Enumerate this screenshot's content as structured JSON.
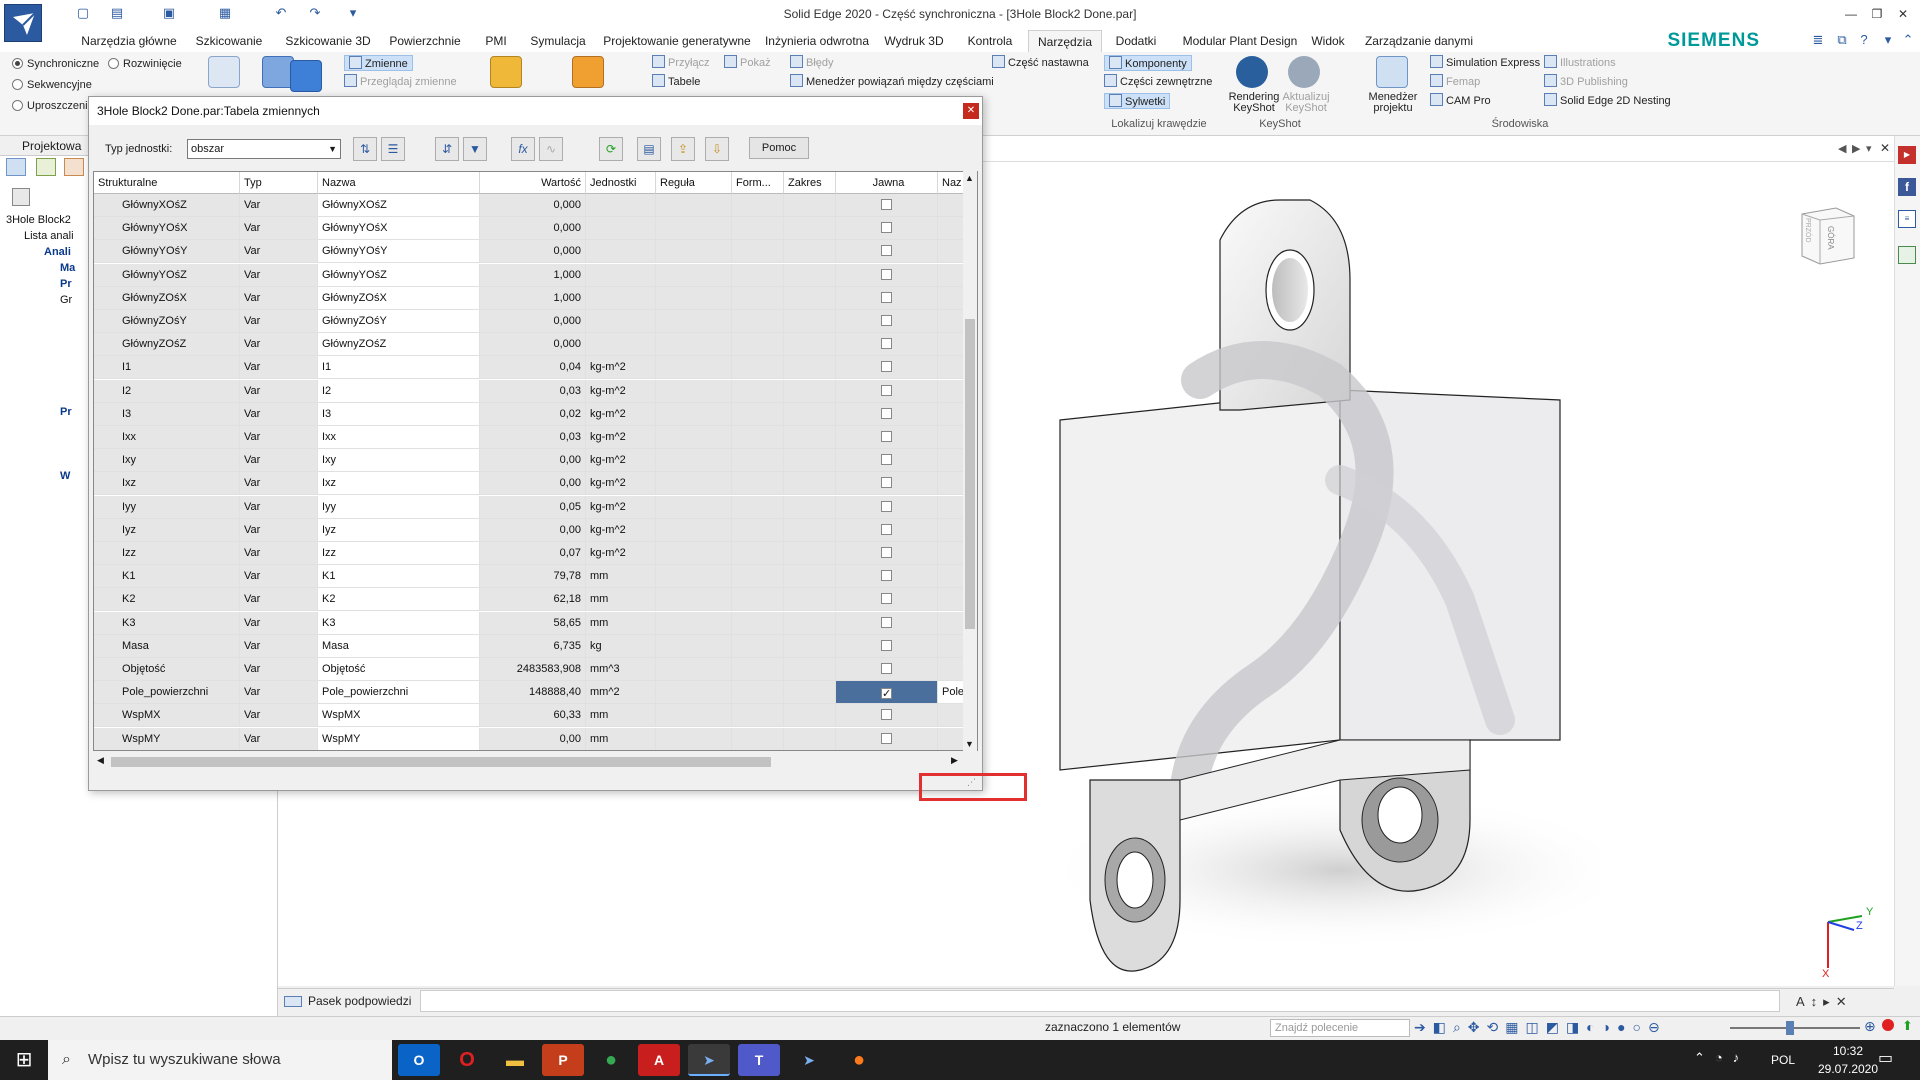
{
  "title": "Solid Edge 2020 - Część synchroniczna - [3Hole Block2 Done.par]",
  "ribbon_tabs": [
    "Narzędzia główne",
    "Szkicowanie",
    "Szkicowanie 3D",
    "Powierzchnie",
    "PMI",
    "Symulacja",
    "Projektowanie generatywne",
    "Inżynieria odwrotna",
    "Wydruk 3D",
    "Kontrola",
    "Narzędzia",
    "Dodatki",
    "Modular Plant Design",
    "Widok",
    "Zarządzanie danymi"
  ],
  "active_tab": "Narzędzia",
  "brand": "SIEMENS",
  "ribbon": {
    "mode_sync": "Synchroniczne",
    "mode_unfold": "Rozwinięcie",
    "mode_seq": "Sekwencyjne",
    "mode_simpl": "Uproszczeni",
    "vars": "Zmienne",
    "browse_vars": "Przeglądaj zmienne",
    "attach": "Przyłącz",
    "show": "Pokaż",
    "tables": "Tabele",
    "errors": "Błędy",
    "rel_manager": "Menedżer powiązań między częściami",
    "adjustable_part": "Część nastawna",
    "components": "Komponenty",
    "external_parts": "Części zewnętrzne",
    "silhouettes": "Sylwetki",
    "locate_edges": "Lokalizuj krawędzie",
    "rendering_keyshot": "Rendering KeyShot",
    "update_keyshot": "Aktualizuj KeyShot",
    "keyshot": "KeyShot",
    "project_manager": "Menedżer projektu",
    "sim_express": "Simulation Express",
    "femap": "Femap",
    "cam_pro": "CAM Pro",
    "illustrations": "Illustrations",
    "publishing_3d": "3D Publishing",
    "nesting": "Solid Edge 2D Nesting",
    "environments": "Środowiska"
  },
  "left_pane": {
    "header": "Projektowa",
    "items": [
      "3Hole Block2",
      "Lista anali",
      "Anali",
      "Ma",
      "Pr",
      "Gr",
      "Pr",
      "W"
    ]
  },
  "dialog": {
    "title": "3Hole Block2 Done.par:Tabela zmiennych",
    "units_label": "Typ jednostki:",
    "units_value": "obszar",
    "help": "Pomoc",
    "columns": [
      "Strukturalne",
      "Typ",
      "Nazwa",
      "Wartość",
      "Jednostki",
      "Reguła",
      "Form...",
      "Zakres",
      "Jawna",
      "Naz"
    ],
    "rows": [
      {
        "s": "GłównyXOśZ",
        "t": "Var",
        "n": "GłównyXOśZ",
        "v": "0,000",
        "u": "",
        "j": false
      },
      {
        "s": "GłównyYOśX",
        "t": "Var",
        "n": "GłównyYOśX",
        "v": "0,000",
        "u": "",
        "j": false
      },
      {
        "s": "GłównyYOśY",
        "t": "Var",
        "n": "GłównyYOśY",
        "v": "0,000",
        "u": "",
        "j": false
      },
      {
        "s": "GłównyYOśZ",
        "t": "Var",
        "n": "GłównyYOśZ",
        "v": "1,000",
        "u": "",
        "j": false
      },
      {
        "s": "GłównyZOśX",
        "t": "Var",
        "n": "GłównyZOśX",
        "v": "1,000",
        "u": "",
        "j": false
      },
      {
        "s": "GłównyZOśY",
        "t": "Var",
        "n": "GłównyZOśY",
        "v": "0,000",
        "u": "",
        "j": false
      },
      {
        "s": "GłównyZOśZ",
        "t": "Var",
        "n": "GłównyZOśZ",
        "v": "0,000",
        "u": "",
        "j": false
      },
      {
        "s": "I1",
        "t": "Var",
        "n": "I1",
        "v": "0,04",
        "u": "kg-m^2",
        "j": false
      },
      {
        "s": "I2",
        "t": "Var",
        "n": "I2",
        "v": "0,03",
        "u": "kg-m^2",
        "j": false
      },
      {
        "s": "I3",
        "t": "Var",
        "n": "I3",
        "v": "0,02",
        "u": "kg-m^2",
        "j": false
      },
      {
        "s": "Ixx",
        "t": "Var",
        "n": "Ixx",
        "v": "0,03",
        "u": "kg-m^2",
        "j": false
      },
      {
        "s": "Ixy",
        "t": "Var",
        "n": "Ixy",
        "v": "0,00",
        "u": "kg-m^2",
        "j": false
      },
      {
        "s": "Ixz",
        "t": "Var",
        "n": "Ixz",
        "v": "0,00",
        "u": "kg-m^2",
        "j": false
      },
      {
        "s": "Iyy",
        "t": "Var",
        "n": "Iyy",
        "v": "0,05",
        "u": "kg-m^2",
        "j": false
      },
      {
        "s": "Iyz",
        "t": "Var",
        "n": "Iyz",
        "v": "0,00",
        "u": "kg-m^2",
        "j": false
      },
      {
        "s": "Izz",
        "t": "Var",
        "n": "Izz",
        "v": "0,07",
        "u": "kg-m^2",
        "j": false
      },
      {
        "s": "K1",
        "t": "Var",
        "n": "K1",
        "v": "79,78",
        "u": "mm",
        "j": false
      },
      {
        "s": "K2",
        "t": "Var",
        "n": "K2",
        "v": "62,18",
        "u": "mm",
        "j": false
      },
      {
        "s": "K3",
        "t": "Var",
        "n": "K3",
        "v": "58,65",
        "u": "mm",
        "j": false
      },
      {
        "s": "Masa",
        "t": "Var",
        "n": "Masa",
        "v": "6,735",
        "u": "kg",
        "j": false
      },
      {
        "s": "Objętość",
        "t": "Var",
        "n": "Objętość",
        "v": "2483583,908",
        "u": "mm^3",
        "j": false
      },
      {
        "s": "Pole_powierzchni",
        "t": "Var",
        "n": "Pole_powierzchni",
        "v": "148888,40",
        "u": "mm^2",
        "j": true,
        "naz": "Pole"
      },
      {
        "s": "WspMX",
        "t": "Var",
        "n": "WspMX",
        "v": "60,33",
        "u": "mm",
        "j": false
      },
      {
        "s": "WspMY",
        "t": "Var",
        "n": "WspMY",
        "v": "0,00",
        "u": "mm",
        "j": false
      }
    ]
  },
  "viewcube_label": "GÓRA",
  "viewcube_side": "PRZÓD",
  "prompt_bar_label": "Pasek podpowiedzi",
  "status_text": "zaznaczono 1 elementów",
  "command_search_placeholder": "Znajdź polecenie",
  "taskbar": {
    "search_placeholder": "Wpisz tu wyszukiwane słowa",
    "lang": "POL",
    "time": "10:32",
    "date": "29.07.2020"
  },
  "axis": {
    "x": "X",
    "y": "Y",
    "z": "Z"
  },
  "colors": {
    "accent": "#2c5aa0",
    "brand": "#009999",
    "highlight": "#e23030",
    "selected_cell": "#4b6f9c"
  }
}
